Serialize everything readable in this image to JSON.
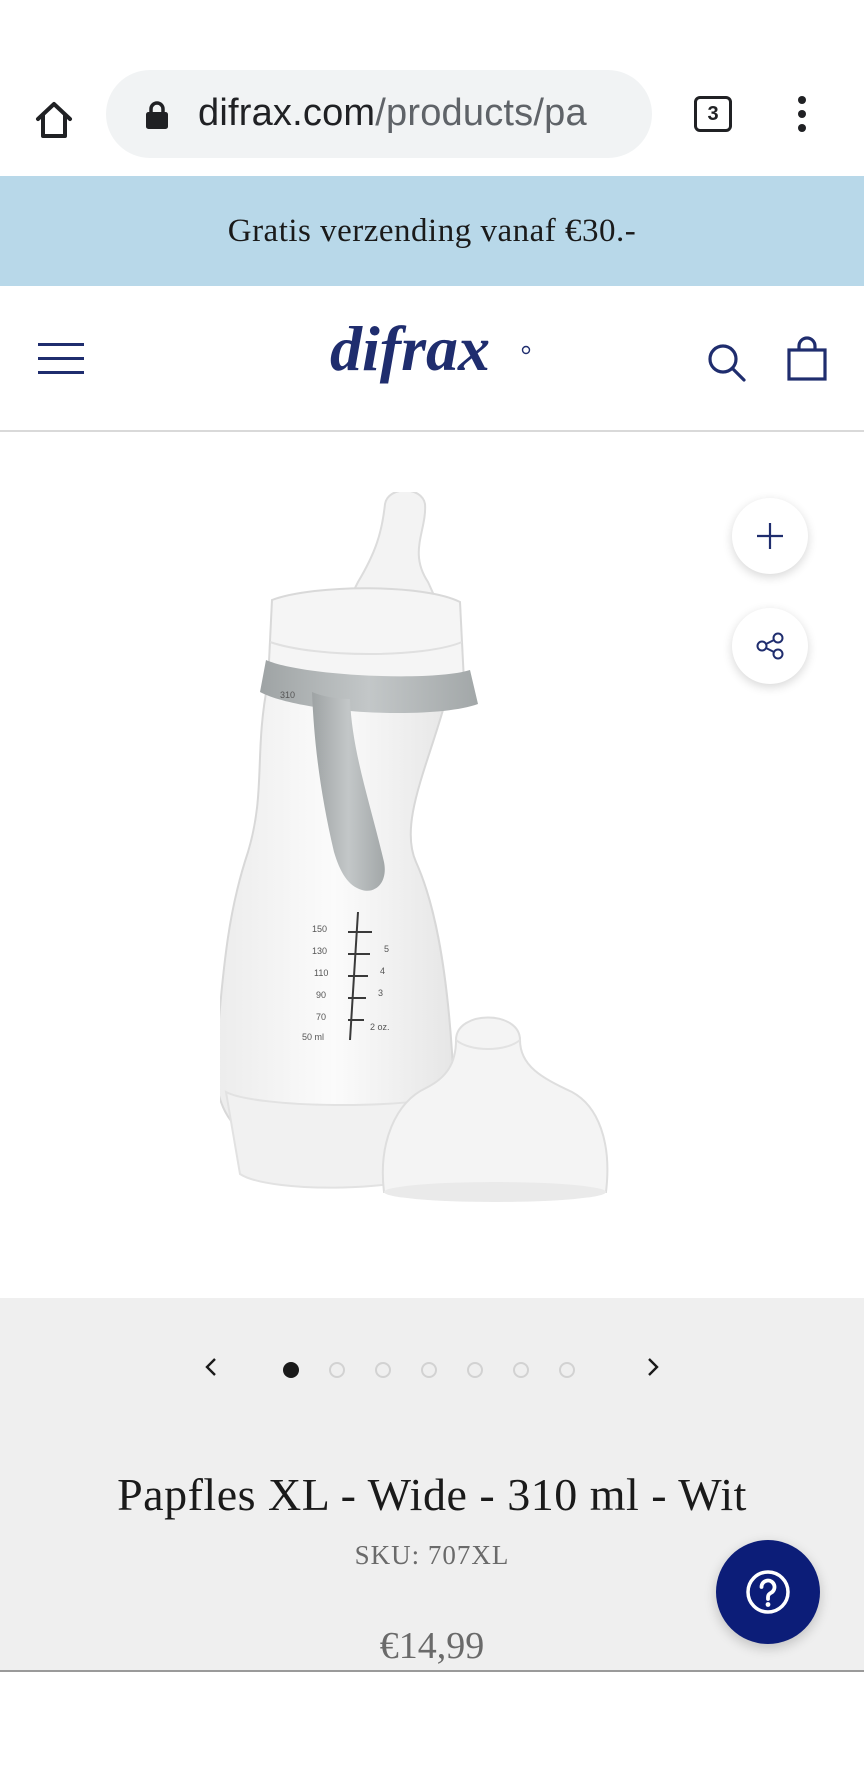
{
  "browser": {
    "url_host": "difrax.com",
    "url_path": "/products/pa",
    "tab_count": "3"
  },
  "banner": {
    "text": "Gratis verzending vanaf €30.-"
  },
  "header": {
    "logo_text": "difrax"
  },
  "gallery": {
    "slide_count": 7,
    "active_slide": 1
  },
  "product": {
    "title": "Papfles XL - Wide - 310 ml - Wit",
    "sku": "SKU: 707XL",
    "price": "€14,99"
  },
  "colors": {
    "brand_navy": "#1f2d6e",
    "banner_bg": "#b8d8e9",
    "help_button": "#0c1d78",
    "info_bg": "#efefef"
  },
  "icons": [
    "home-icon",
    "lock-icon",
    "tabs-icon",
    "more-vert-icon",
    "hamburger-icon",
    "search-icon",
    "cart-icon",
    "zoom-plus-icon",
    "share-icon",
    "chevron-left-icon",
    "chevron-right-icon",
    "help-icon"
  ]
}
